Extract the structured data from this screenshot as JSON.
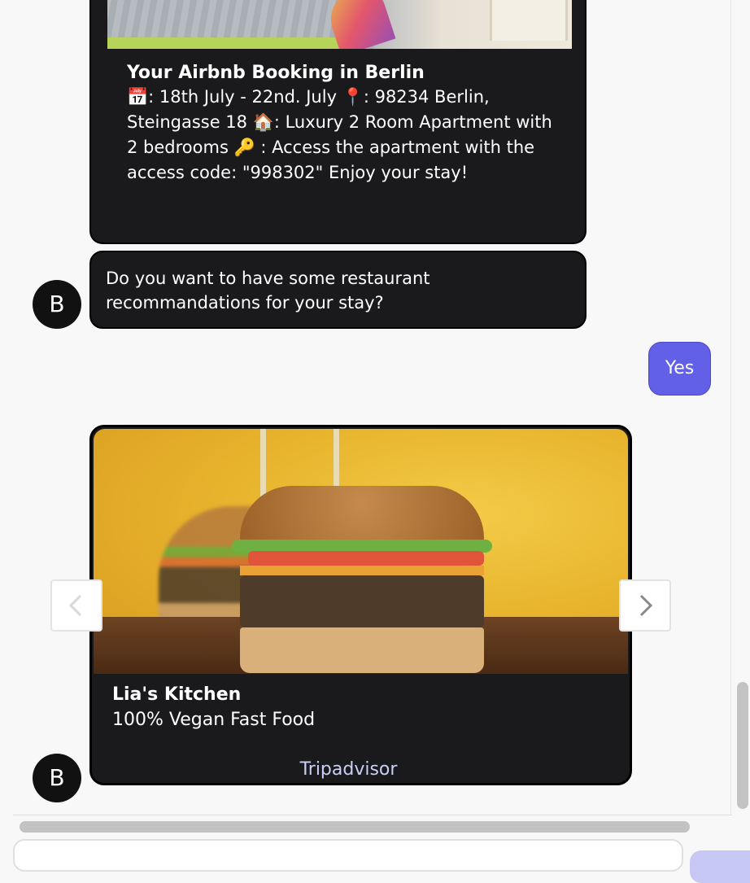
{
  "chat": {
    "booking_card": {
      "title": "Your Airbnb Booking in Berlin",
      "body": "📅: 18th July - 22nd. July 📍: 98234 Berlin, Steingasse 18 🏠: Luxury 2 Room Apartment with 2 bedrooms 🔑 : Access the apartment with the access code: \"998302\" Enjoy your stay!"
    },
    "bot_message": "Do you want to have some restaurant recommandations for your stay?",
    "bot_avatar_letter": "B",
    "user_message": "Yes",
    "restaurant_card": {
      "title": "Lia's Kitchen",
      "subtitle": "100% Vegan Fast Food",
      "link_label": "Tripadvisor"
    }
  },
  "colors": {
    "bubble_bg": "#1a1a1c",
    "user_bubble_bg": "#6160e6",
    "link_color": "#c9d0f6",
    "page_bg": "#f8f8f8"
  },
  "icons": {
    "carousel_prev": "chevron-left-icon",
    "carousel_next": "chevron-right-icon"
  }
}
